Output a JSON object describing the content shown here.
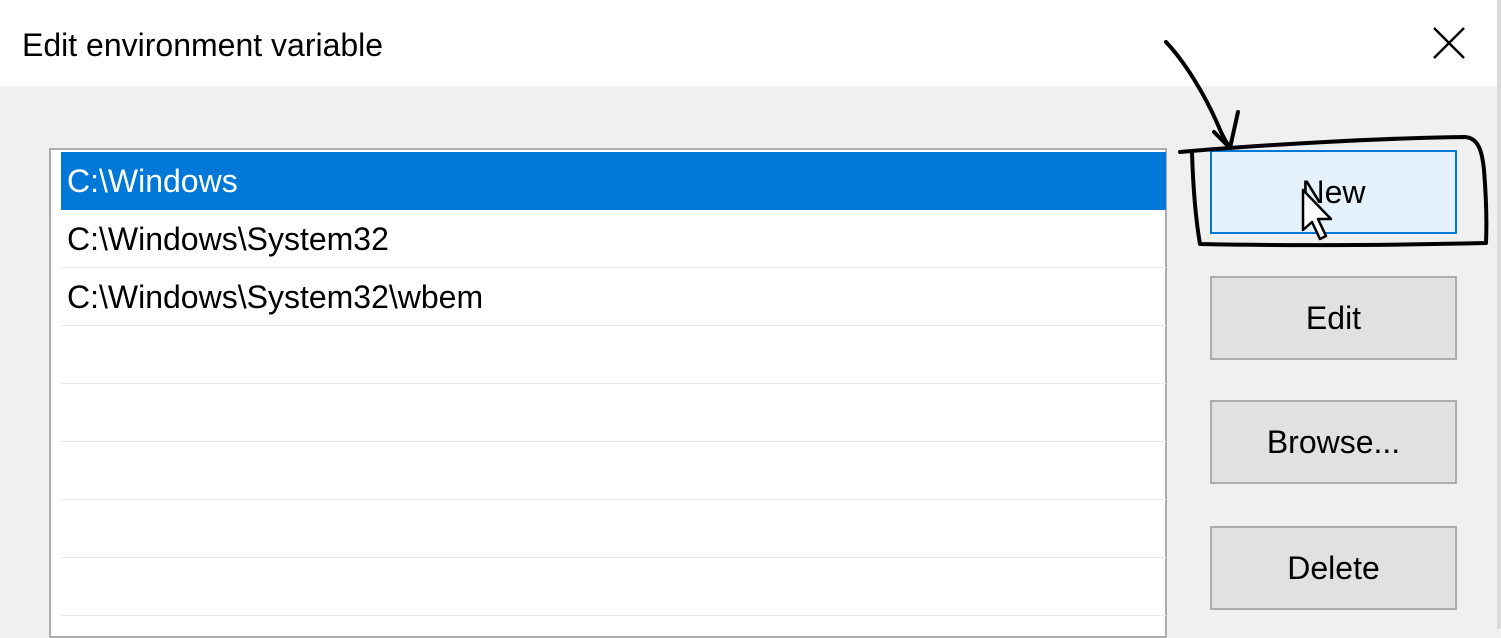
{
  "window": {
    "title": "Edit environment variable",
    "close_icon": "close-icon"
  },
  "list": {
    "items": [
      {
        "text": "C:\\Windows",
        "selected": true
      },
      {
        "text": "C:\\Windows\\System32",
        "selected": false
      },
      {
        "text": "C:\\Windows\\System32\\wbem",
        "selected": false
      }
    ]
  },
  "buttons": {
    "new_label": "New",
    "edit_label": "Edit",
    "browse_label": "Browse...",
    "delete_label": "Delete"
  },
  "colors": {
    "selection": "#0078d7",
    "button_face": "#e1e1e1",
    "button_hover": "#e5f1fb",
    "window_bg": "#f0f0f0"
  }
}
